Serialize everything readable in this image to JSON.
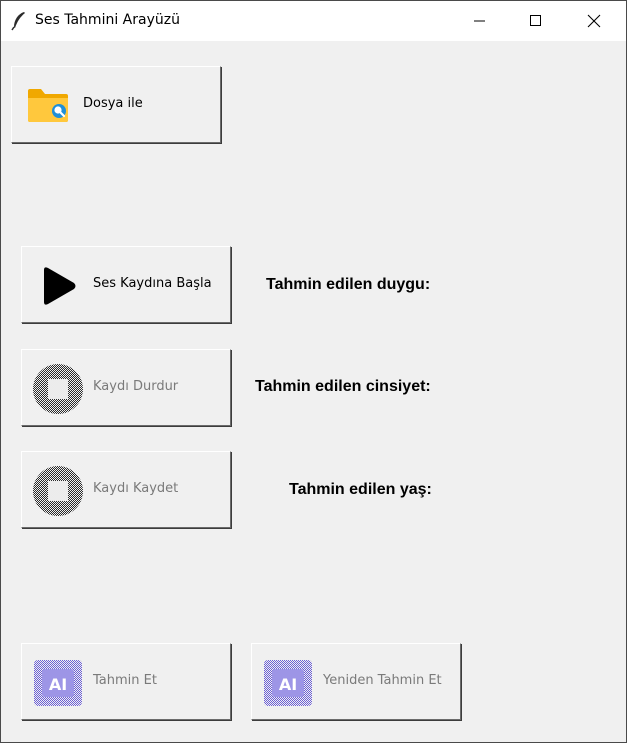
{
  "window": {
    "title": "Ses Tahmini Arayüzü",
    "icon": "feather-icon"
  },
  "buttons": {
    "file": {
      "label": "Dosya ile",
      "icon": "folder-search-icon",
      "enabled": true
    },
    "start_record": {
      "label": "Ses Kaydına Başla",
      "icon": "play-icon",
      "enabled": true
    },
    "stop_record": {
      "label": "Kaydı Durdur",
      "icon": "stop-icon",
      "enabled": false
    },
    "save_record": {
      "label": "Kaydı Kaydet",
      "icon": "stop-icon",
      "enabled": false
    },
    "predict": {
      "label": "Tahmin Et",
      "icon": "ai-chip-icon",
      "enabled": false
    },
    "repredict": {
      "label": "Yeniden Tahmin Et",
      "icon": "ai-chip-icon",
      "enabled": false
    }
  },
  "results": {
    "emotion_label": "Tahmin edilen duygu:",
    "gender_label": "Tahmin edilen cinsiyet:",
    "age_label": "Tahmin edilen yaş:"
  },
  "colors": {
    "folder": "#f5b400",
    "ai_chip": "#6b5fd6",
    "window_bg": "#f0f0f0"
  }
}
